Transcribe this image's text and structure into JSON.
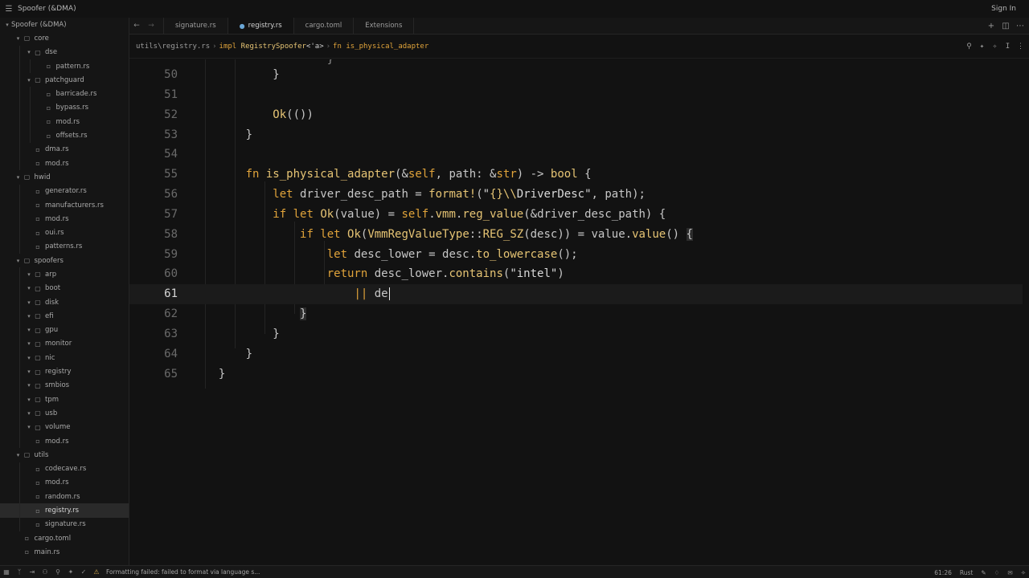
{
  "window": {
    "title": "Spoofer (&DMA)",
    "sign_in": "Sign In"
  },
  "tabs": [
    {
      "label": "signature.rs"
    },
    {
      "label": "registry.rs",
      "active": true
    },
    {
      "label": "cargo.toml"
    },
    {
      "label": "Extensions"
    }
  ],
  "breadcrumb": {
    "path": "utils\\registry.rs",
    "impl_kw": "impl",
    "impl_type": "RegistrySpoofer",
    "impl_lt": "<'a>",
    "fn_kw": "fn",
    "fn_name": "is_physical_adapter"
  },
  "sidebar": {
    "root": "Spoofer (&DMA)",
    "items": [
      {
        "label": "core",
        "type": "folder"
      },
      {
        "label": "dse",
        "type": "folder"
      },
      {
        "label": "pattern.rs",
        "type": "file"
      },
      {
        "label": "patchguard",
        "type": "folder"
      },
      {
        "label": "barricade.rs",
        "type": "file"
      },
      {
        "label": "bypass.rs",
        "type": "file"
      },
      {
        "label": "mod.rs",
        "type": "file"
      },
      {
        "label": "offsets.rs",
        "type": "file"
      },
      {
        "label": "dma.rs",
        "type": "file"
      },
      {
        "label": "mod.rs",
        "type": "file"
      },
      {
        "label": "hwid",
        "type": "folder"
      },
      {
        "label": "generator.rs",
        "type": "file"
      },
      {
        "label": "manufacturers.rs",
        "type": "file"
      },
      {
        "label": "mod.rs",
        "type": "file"
      },
      {
        "label": "oui.rs",
        "type": "file"
      },
      {
        "label": "patterns.rs",
        "type": "file"
      },
      {
        "label": "spoofers",
        "type": "folder"
      },
      {
        "label": "arp",
        "type": "folder"
      },
      {
        "label": "boot",
        "type": "folder"
      },
      {
        "label": "disk",
        "type": "folder"
      },
      {
        "label": "efi",
        "type": "folder"
      },
      {
        "label": "gpu",
        "type": "folder"
      },
      {
        "label": "monitor",
        "type": "folder"
      },
      {
        "label": "nic",
        "type": "folder"
      },
      {
        "label": "registry",
        "type": "folder"
      },
      {
        "label": "smbios",
        "type": "folder"
      },
      {
        "label": "tpm",
        "type": "folder"
      },
      {
        "label": "usb",
        "type": "folder"
      },
      {
        "label": "volume",
        "type": "folder"
      },
      {
        "label": "mod.rs",
        "type": "file"
      },
      {
        "label": "utils",
        "type": "folder"
      },
      {
        "label": "codecave.rs",
        "type": "file"
      },
      {
        "label": "mod.rs",
        "type": "file"
      },
      {
        "label": "random.rs",
        "type": "file"
      },
      {
        "label": "registry.rs",
        "type": "file",
        "selected": true
      },
      {
        "label": "signature.rs",
        "type": "file"
      },
      {
        "label": "cargo.toml",
        "type": "file"
      },
      {
        "label": "main.rs",
        "type": "file"
      }
    ]
  },
  "editor": {
    "line_numbers": [
      "50",
      "51",
      "52",
      "53",
      "54",
      "55",
      "56",
      "57",
      "58",
      "59",
      "60",
      "61",
      "62",
      "63",
      "64",
      "65"
    ],
    "current_line": "61",
    "typed_text": "de"
  },
  "status": {
    "message": "Formatting failed: failed to format via language s...",
    "cursor": "61:26",
    "language": "Rust"
  }
}
